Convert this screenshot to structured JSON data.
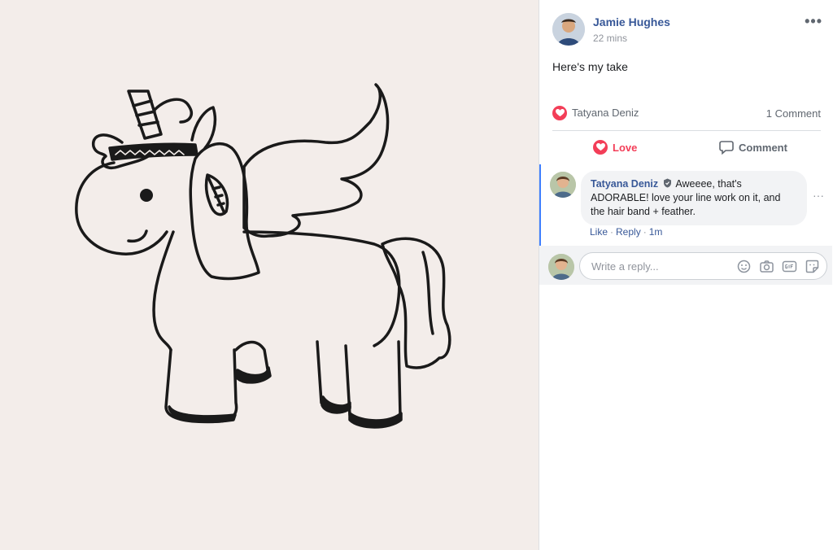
{
  "post": {
    "author": "Jamie Hughes",
    "time": "22 mins",
    "text": "Here's my take",
    "more_label": "•••"
  },
  "reactions": {
    "reactor": "Tatyana Deniz",
    "comment_count": "1 Comment",
    "icon": "love-heart-icon"
  },
  "actions": {
    "love_label": "Love",
    "comment_label": "Comment"
  },
  "comment": {
    "author": "Tatyana Deniz",
    "text": "Aweeee, that's ADORABLE! love your line work on it, and the hair band + feather.",
    "like": "Like",
    "reply": "Reply",
    "time": "1m",
    "separator": "·",
    "more_label": "···"
  },
  "reply_box": {
    "placeholder": "Write a reply...",
    "icons": [
      "emoji-icon",
      "camera-icon",
      "gif-icon",
      "sticker-icon"
    ]
  },
  "colors": {
    "link_blue": "#385898",
    "love_red": "#f33e58",
    "photo_bg": "#f3edea"
  }
}
